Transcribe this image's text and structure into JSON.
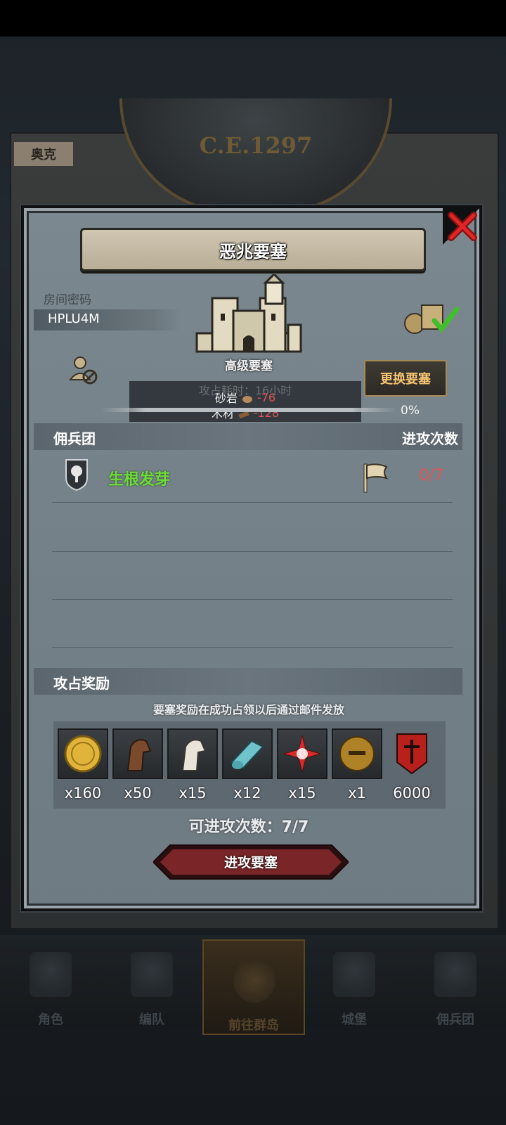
{
  "background": {
    "era": "C.E.1297",
    "tag": "奥克"
  },
  "dialog": {
    "title": "恶兆要塞",
    "room_code_label": "房间密码",
    "room_code": "HPLU4M",
    "fortress_level": "高级要塞",
    "change_button": "更换要塞",
    "resources": {
      "ghost_line": "攻占耗时：16小时",
      "items": [
        {
          "name": "砂岩",
          "value": "-76",
          "icon": "rock-icon"
        },
        {
          "name": "木材",
          "value": "-128",
          "icon": "wood-icon"
        }
      ]
    },
    "progress": "0%",
    "mercenary_section": {
      "left": "佣兵团",
      "right": "进攻次数"
    },
    "guild": {
      "name": "生根发芽",
      "attacks": "0/7"
    },
    "reward_section": "攻占奖励",
    "reward_note": "要塞奖励在成功占领以后通过邮件发放",
    "rewards": [
      {
        "icon": "gold-coin-icon",
        "qty": "x160"
      },
      {
        "icon": "brown-horse-icon",
        "qty": "x50"
      },
      {
        "icon": "white-horse-icon",
        "qty": "x15"
      },
      {
        "icon": "cloth-roll-icon",
        "qty": "x12"
      },
      {
        "icon": "red-star-icon",
        "qty": "x15"
      },
      {
        "icon": "golden-helmet-icon",
        "qty": "x1"
      },
      {
        "icon": "banner-icon",
        "qty": "6000"
      }
    ],
    "attack_count": "可进攻次数：7/7",
    "attack_button": "进攻要塞"
  },
  "nav": [
    {
      "label": "角色"
    },
    {
      "label": "编队"
    },
    {
      "label": "前往群岛"
    },
    {
      "label": "城堡"
    },
    {
      "label": "佣兵团"
    }
  ],
  "colors": {
    "guild_name": "#6ddb3a",
    "negative": "#e05656",
    "button_text": "#f6c372"
  }
}
